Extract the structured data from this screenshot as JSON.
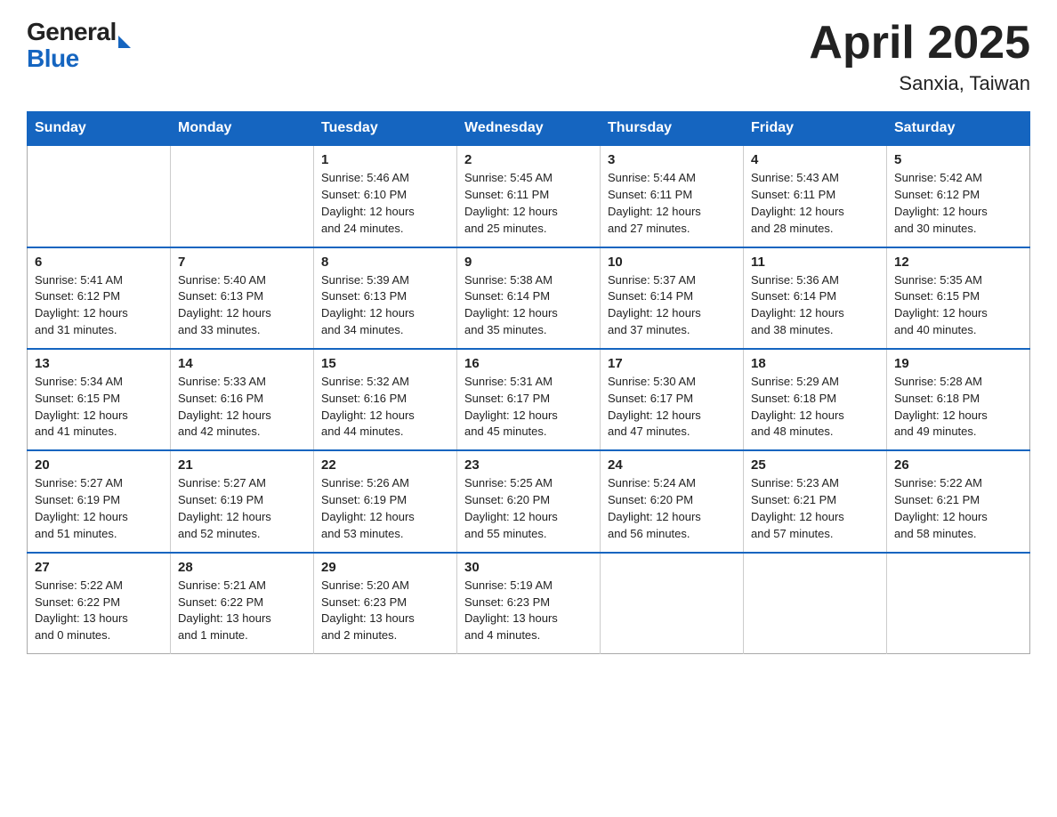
{
  "header": {
    "logo_general": "General",
    "logo_blue": "Blue",
    "title": "April 2025",
    "subtitle": "Sanxia, Taiwan"
  },
  "calendar": {
    "days_of_week": [
      "Sunday",
      "Monday",
      "Tuesday",
      "Wednesday",
      "Thursday",
      "Friday",
      "Saturday"
    ],
    "weeks": [
      [
        {
          "day": "",
          "info": ""
        },
        {
          "day": "",
          "info": ""
        },
        {
          "day": "1",
          "info": "Sunrise: 5:46 AM\nSunset: 6:10 PM\nDaylight: 12 hours\nand 24 minutes."
        },
        {
          "day": "2",
          "info": "Sunrise: 5:45 AM\nSunset: 6:11 PM\nDaylight: 12 hours\nand 25 minutes."
        },
        {
          "day": "3",
          "info": "Sunrise: 5:44 AM\nSunset: 6:11 PM\nDaylight: 12 hours\nand 27 minutes."
        },
        {
          "day": "4",
          "info": "Sunrise: 5:43 AM\nSunset: 6:11 PM\nDaylight: 12 hours\nand 28 minutes."
        },
        {
          "day": "5",
          "info": "Sunrise: 5:42 AM\nSunset: 6:12 PM\nDaylight: 12 hours\nand 30 minutes."
        }
      ],
      [
        {
          "day": "6",
          "info": "Sunrise: 5:41 AM\nSunset: 6:12 PM\nDaylight: 12 hours\nand 31 minutes."
        },
        {
          "day": "7",
          "info": "Sunrise: 5:40 AM\nSunset: 6:13 PM\nDaylight: 12 hours\nand 33 minutes."
        },
        {
          "day": "8",
          "info": "Sunrise: 5:39 AM\nSunset: 6:13 PM\nDaylight: 12 hours\nand 34 minutes."
        },
        {
          "day": "9",
          "info": "Sunrise: 5:38 AM\nSunset: 6:14 PM\nDaylight: 12 hours\nand 35 minutes."
        },
        {
          "day": "10",
          "info": "Sunrise: 5:37 AM\nSunset: 6:14 PM\nDaylight: 12 hours\nand 37 minutes."
        },
        {
          "day": "11",
          "info": "Sunrise: 5:36 AM\nSunset: 6:14 PM\nDaylight: 12 hours\nand 38 minutes."
        },
        {
          "day": "12",
          "info": "Sunrise: 5:35 AM\nSunset: 6:15 PM\nDaylight: 12 hours\nand 40 minutes."
        }
      ],
      [
        {
          "day": "13",
          "info": "Sunrise: 5:34 AM\nSunset: 6:15 PM\nDaylight: 12 hours\nand 41 minutes."
        },
        {
          "day": "14",
          "info": "Sunrise: 5:33 AM\nSunset: 6:16 PM\nDaylight: 12 hours\nand 42 minutes."
        },
        {
          "day": "15",
          "info": "Sunrise: 5:32 AM\nSunset: 6:16 PM\nDaylight: 12 hours\nand 44 minutes."
        },
        {
          "day": "16",
          "info": "Sunrise: 5:31 AM\nSunset: 6:17 PM\nDaylight: 12 hours\nand 45 minutes."
        },
        {
          "day": "17",
          "info": "Sunrise: 5:30 AM\nSunset: 6:17 PM\nDaylight: 12 hours\nand 47 minutes."
        },
        {
          "day": "18",
          "info": "Sunrise: 5:29 AM\nSunset: 6:18 PM\nDaylight: 12 hours\nand 48 minutes."
        },
        {
          "day": "19",
          "info": "Sunrise: 5:28 AM\nSunset: 6:18 PM\nDaylight: 12 hours\nand 49 minutes."
        }
      ],
      [
        {
          "day": "20",
          "info": "Sunrise: 5:27 AM\nSunset: 6:19 PM\nDaylight: 12 hours\nand 51 minutes."
        },
        {
          "day": "21",
          "info": "Sunrise: 5:27 AM\nSunset: 6:19 PM\nDaylight: 12 hours\nand 52 minutes."
        },
        {
          "day": "22",
          "info": "Sunrise: 5:26 AM\nSunset: 6:19 PM\nDaylight: 12 hours\nand 53 minutes."
        },
        {
          "day": "23",
          "info": "Sunrise: 5:25 AM\nSunset: 6:20 PM\nDaylight: 12 hours\nand 55 minutes."
        },
        {
          "day": "24",
          "info": "Sunrise: 5:24 AM\nSunset: 6:20 PM\nDaylight: 12 hours\nand 56 minutes."
        },
        {
          "day": "25",
          "info": "Sunrise: 5:23 AM\nSunset: 6:21 PM\nDaylight: 12 hours\nand 57 minutes."
        },
        {
          "day": "26",
          "info": "Sunrise: 5:22 AM\nSunset: 6:21 PM\nDaylight: 12 hours\nand 58 minutes."
        }
      ],
      [
        {
          "day": "27",
          "info": "Sunrise: 5:22 AM\nSunset: 6:22 PM\nDaylight: 13 hours\nand 0 minutes."
        },
        {
          "day": "28",
          "info": "Sunrise: 5:21 AM\nSunset: 6:22 PM\nDaylight: 13 hours\nand 1 minute."
        },
        {
          "day": "29",
          "info": "Sunrise: 5:20 AM\nSunset: 6:23 PM\nDaylight: 13 hours\nand 2 minutes."
        },
        {
          "day": "30",
          "info": "Sunrise: 5:19 AM\nSunset: 6:23 PM\nDaylight: 13 hours\nand 4 minutes."
        },
        {
          "day": "",
          "info": ""
        },
        {
          "day": "",
          "info": ""
        },
        {
          "day": "",
          "info": ""
        }
      ]
    ]
  }
}
